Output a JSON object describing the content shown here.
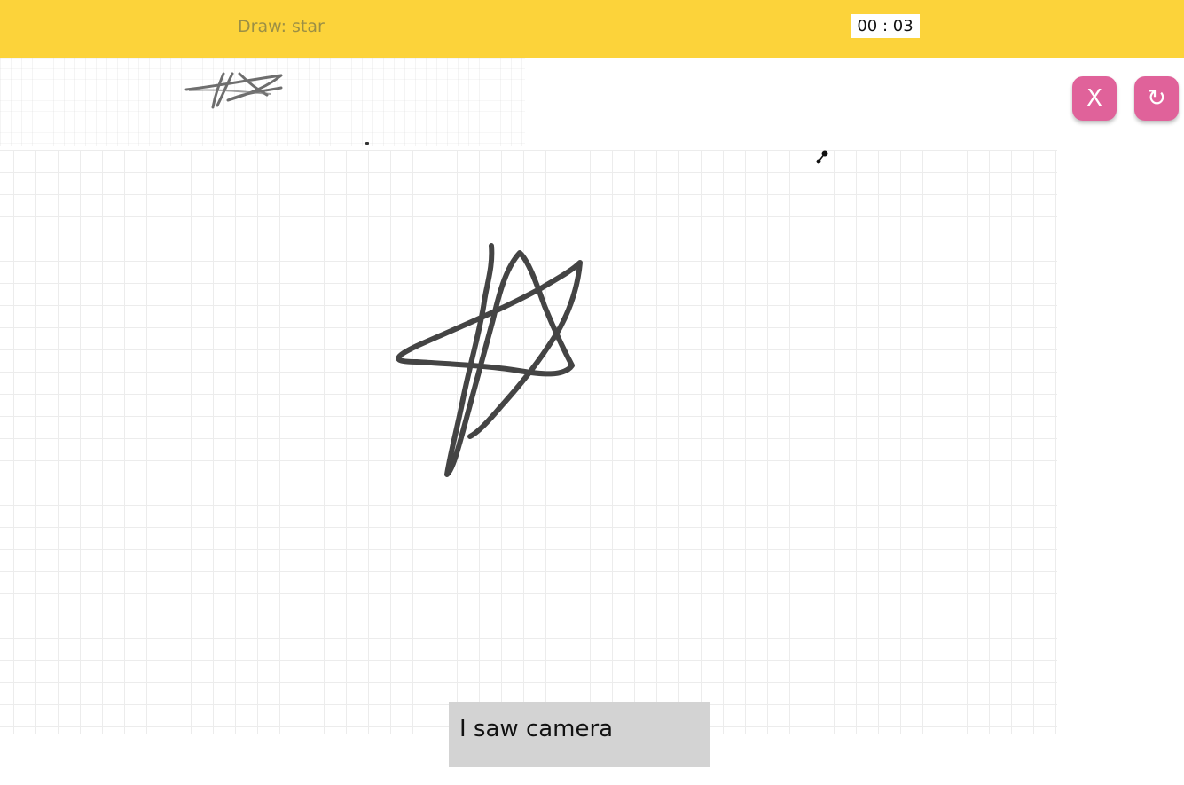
{
  "header": {
    "prompt_text": "Draw: star",
    "timer_text": "00 : 03",
    "background_color": "#fcd33a"
  },
  "controls": {
    "close_label": "X",
    "close_icon": "close-icon",
    "reset_label": "↻",
    "reset_icon": "reset-icon",
    "button_color": "#e0629a"
  },
  "canvas": {
    "drawing_subject": "star",
    "stroke_color": "#444444"
  },
  "guess": {
    "text": "I saw camera"
  }
}
